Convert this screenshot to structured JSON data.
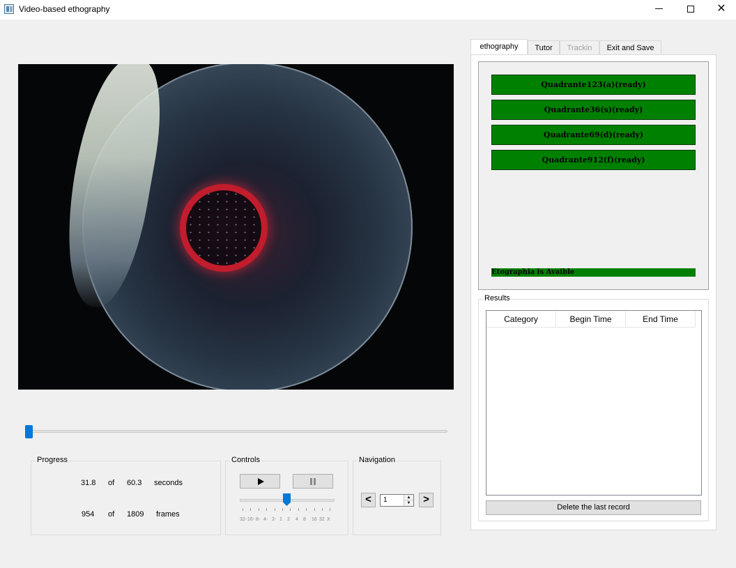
{
  "window": {
    "title": "Video-based ethography",
    "minimize_icon": "minimize-icon",
    "maximize_icon": "maximize-icon",
    "close_icon": "close-icon"
  },
  "progress": {
    "title": "Progress",
    "seconds_current": "31.8",
    "seconds_of": "of",
    "seconds_total": "60.3",
    "seconds_unit": "seconds",
    "frames_current": "954",
    "frames_of": "of",
    "frames_total": "1809",
    "frames_unit": "frames"
  },
  "timeline": {
    "position_fraction": 0.0
  },
  "controls": {
    "title": "Controls",
    "play_icon": "play-icon",
    "pause_icon": "pause-icon",
    "speed_labels": [
      "32-",
      "16-",
      "8-",
      "4-",
      "2-",
      "1",
      "2",
      "4",
      "8",
      "16",
      "32",
      "X"
    ],
    "speed_selected": "1"
  },
  "navigation": {
    "title": "Navigation",
    "prev_label": "<",
    "next_label": ">",
    "value": "1"
  },
  "tabs": [
    {
      "label": "ethography",
      "state": "active"
    },
    {
      "label": "Tutor",
      "state": "normal"
    },
    {
      "label": "Trackin",
      "state": "disabled"
    },
    {
      "label": "Exit and Save",
      "state": "normal"
    }
  ],
  "ethography": {
    "buttons": [
      "Quadrante123(a)(ready)",
      "Quadrante36(s)(ready)",
      "Quadrante69(d)(ready)",
      "Quadrante912(f)(ready)"
    ],
    "status": "Etographia is Avaible",
    "button_color": "#008000"
  },
  "results": {
    "title": "Results",
    "columns": [
      "Category",
      "Begin Time",
      "End Time"
    ],
    "rows": [],
    "delete_label": "Delete the last record"
  }
}
